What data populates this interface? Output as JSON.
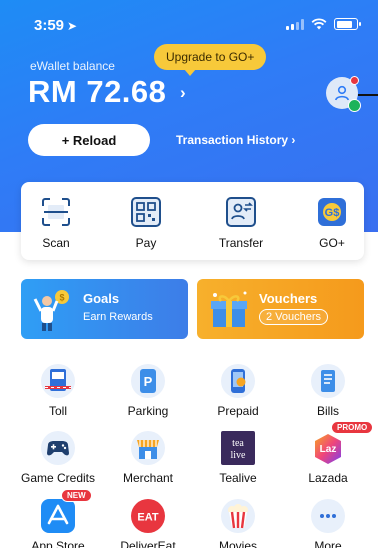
{
  "status_bar": {
    "time": "3:59"
  },
  "header": {
    "upgrade_label": "Upgrade to GO+",
    "ewallet_label": "eWallet balance",
    "balance": "RM 72.68",
    "reload_label": "+ Reload",
    "transaction_history_label": "Transaction History"
  },
  "quick_actions": [
    {
      "label": "Scan",
      "icon": "scan-icon"
    },
    {
      "label": "Pay",
      "icon": "qr-code-icon"
    },
    {
      "label": "Transfer",
      "icon": "transfer-icon"
    },
    {
      "label": "GO+",
      "icon": "go-plus-icon"
    }
  ],
  "banners": {
    "goals": {
      "title": "Goals",
      "subtitle": "Earn Rewards"
    },
    "vouchers": {
      "title": "Vouchers",
      "count_label": "2 Vouchers"
    }
  },
  "services": [
    {
      "label": "Toll",
      "icon": "toll-icon"
    },
    {
      "label": "Parking",
      "icon": "parking-icon"
    },
    {
      "label": "Prepaid",
      "icon": "prepaid-icon"
    },
    {
      "label": "Bills",
      "icon": "bills-icon"
    },
    {
      "label": "Game Credits",
      "icon": "gamepad-icon"
    },
    {
      "label": "Merchant",
      "icon": "merchant-icon"
    },
    {
      "label": "Tealive",
      "icon": "tealive-logo",
      "logo_text": "tea live"
    },
    {
      "label": "Lazada",
      "icon": "lazada-logo",
      "badge": "PROMO",
      "logo_text": "Laz"
    },
    {
      "label": "App Store",
      "icon": "app-store-icon",
      "badge": "NEW"
    },
    {
      "label": "DeliverEat",
      "icon": "delivereat-logo",
      "logo_text": "EAT"
    },
    {
      "label": "Movies",
      "icon": "popcorn-icon"
    },
    {
      "label": "More",
      "icon": "more-icon"
    }
  ],
  "colors": {
    "brand_blue": "#2f7cf6",
    "upgrade_yellow": "#f7c93a",
    "voucher_orange": "#f7a522",
    "badge_red": "#e8363f"
  }
}
